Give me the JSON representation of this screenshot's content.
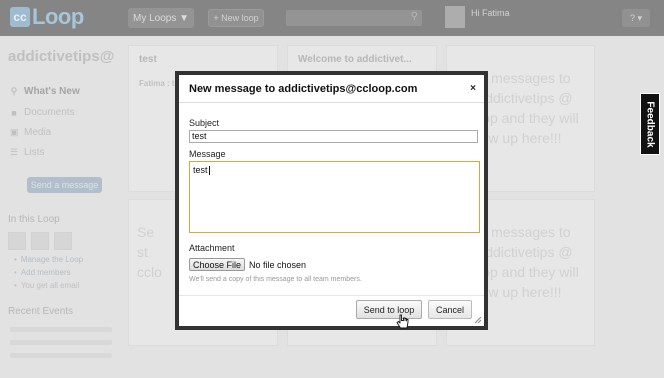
{
  "app": {
    "logo_cc": "cc",
    "logo_text": "Loop",
    "accent_color": "#7db4db"
  },
  "topbar": {
    "my_loops_label": "My Loops ▼",
    "new_loop_label": "+ New loop",
    "search_placeholder": "",
    "user_greeting": "Hi Fatima",
    "help_label": "? ▾"
  },
  "sidebar": {
    "loop_name": "addictivetips@",
    "nav": [
      {
        "label": "What's New",
        "icon": "pin-icon"
      },
      {
        "label": "Documents",
        "icon": "document-icon"
      },
      {
        "label": "Media",
        "icon": "media-icon"
      },
      {
        "label": "Lists",
        "icon": "list-icon"
      }
    ],
    "send_message_label": "Send a message",
    "in_this_loop_heading": "In this Loop",
    "links": [
      "Manage the Loop",
      "Add members",
      "You get all email"
    ],
    "recent_events_heading": "Recent Events"
  },
  "cards": {
    "card1_title": "test",
    "card1_author": "Fatima : te",
    "card2_title": "Welcome to addictivet...",
    "placeholder_top": "d messages to\naddictivetips @\nloop and they will\nw up here!!!",
    "placeholder_left": "Se\nst\ncclo",
    "placeholder_bottom": "d messages to\naddictivetips @\nloop and they will\nw up here!!!"
  },
  "feedback_label": "Feedback",
  "modal": {
    "title": "New message to addictivetips@ccloop.com",
    "close_label": "×",
    "subject_label": "Subject",
    "subject_value": "test",
    "message_label": "Message",
    "message_value": "test",
    "attachment_label": "Attachment",
    "choose_file_label": "Choose File",
    "no_file_label": "No file chosen",
    "copy_note": "We'll send a copy of this message to all team members.",
    "send_label": "Send to loop",
    "cancel_label": "Cancel"
  }
}
